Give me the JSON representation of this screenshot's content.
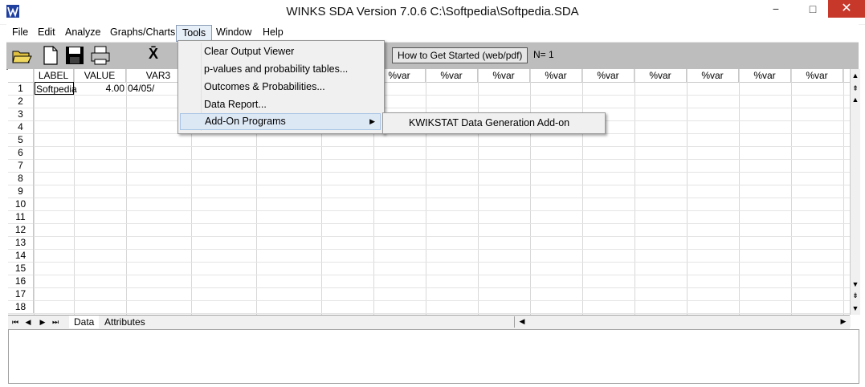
{
  "window": {
    "title": "WINKS SDA Version 7.0.6 C:\\Softpedia\\Softpedia.SDA",
    "min": "−",
    "max": "□",
    "close": "✕"
  },
  "menubar": [
    "File",
    "Edit",
    "Analyze",
    "Graphs/Charts",
    "Tools",
    "Window",
    "Help"
  ],
  "toolbar": {
    "get_started_label": "How to Get Started (web/pdf)",
    "n_count": "N= 1",
    "icons": [
      "open-folder-icon",
      "new-file-icon",
      "save-icon",
      "print-icon",
      "mean-xbar-icon"
    ],
    "xbar": "X̄"
  },
  "grid": {
    "columns": [
      "LABEL",
      "VALUE",
      "VAR3",
      "",
      "",
      "",
      "%var",
      "%var",
      "%var",
      "%var",
      "%var",
      "%var",
      "%var",
      "%var",
      "%var"
    ],
    "row_numbers": [
      "1",
      "2",
      "3",
      "4",
      "5",
      "6",
      "7",
      "8",
      "9",
      "10",
      "11",
      "12",
      "13",
      "14",
      "15",
      "16",
      "17",
      "18"
    ],
    "row1": {
      "label": "Softpedia",
      "value": "4.00",
      "var3": "04/05/"
    }
  },
  "sheet_tabs": [
    "Data",
    "Attributes"
  ],
  "tools_menu": {
    "items": [
      "Clear Output Viewer",
      "p-values and probability tables...",
      "Outcomes & Probabilities...",
      "Data Report...",
      "Add-On Programs"
    ],
    "submenu_items": [
      "KWIKSTAT Data Generation Add-on"
    ]
  },
  "colors": {
    "toolbar_bg": "#bdbdbd",
    "menu_highlight": "#dde8f5",
    "close_button": "#c7382b"
  }
}
